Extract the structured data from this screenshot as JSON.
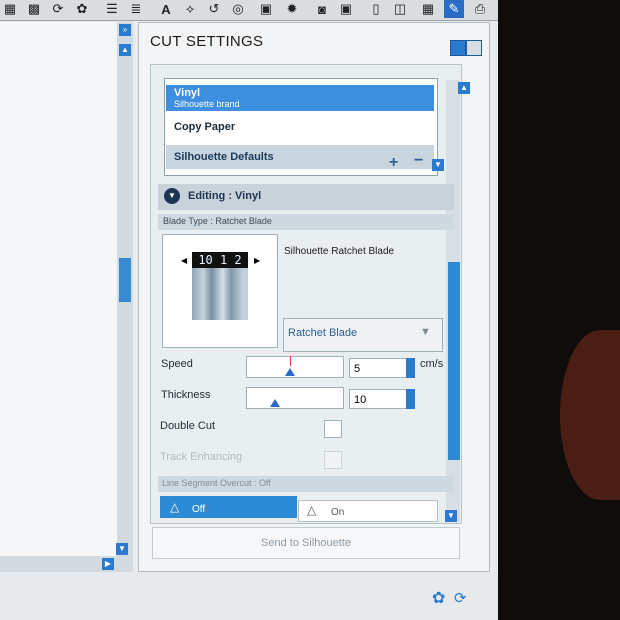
{
  "panel": {
    "title": "CUT SETTINGS",
    "materials": [
      {
        "name": "Vinyl",
        "sub": "Silhouette brand",
        "selected": true
      },
      {
        "name": "Copy Paper",
        "sub": "",
        "selected": false
      },
      {
        "name": "Silhouette Defaults",
        "sub": "",
        "selected": false
      }
    ],
    "editing_title": "Editing : Vinyl",
    "blade_type": "Blade Type : Ratchet Blade",
    "blade_number": "10 1 2",
    "blade_name": "Silhouette Ratchet Blade",
    "blade_select": "Ratchet Blade",
    "speed_label": "Speed",
    "speed_value": "5",
    "speed_level": 5,
    "speed_unit": "cm/s",
    "thickness_label": "Thickness",
    "thickness_value": "10",
    "thickness_level": 10,
    "double_cut_label": "Double Cut",
    "track_enhancing_label": "Track Enhancing",
    "overcut_label": "Line Segment Overcut : Off",
    "overcut_off": "Off",
    "overcut_on": "On",
    "send_button": "Send to Silhouette"
  },
  "colors": {
    "accent": "#2a7bd0",
    "selected_row": "#3f8fe0",
    "header_band": "#c7d2da"
  }
}
